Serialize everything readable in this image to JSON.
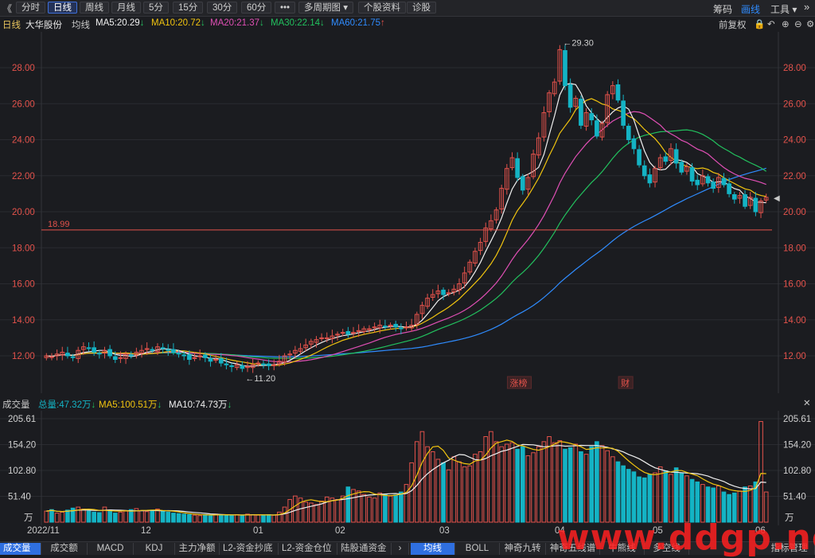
{
  "toolbar": {
    "back_glyph": "《",
    "tabs": [
      "分时",
      "日线",
      "周线",
      "月线",
      "5分",
      "15分",
      "30分",
      "60分",
      "•••",
      "多周期图",
      "个股资料",
      "诊股"
    ],
    "active_tab": "日线",
    "right_items": [
      "筹码",
      "画线",
      "工具"
    ],
    "active_right": "画线"
  },
  "ma_header": {
    "period": "日线",
    "stock_name": "大华股份",
    "avg_line": "均线",
    "ma5": "MA5:20.29",
    "ma10": "MA10:20.72",
    "ma20": "MA20:21.37",
    "ma30": "MA30:22.14",
    "ma60": "MA60:21.75",
    "adjust": "前复权"
  },
  "colors": {
    "up": "#e3524b",
    "down": "#14b3c4",
    "ma5": "#f0f0f0",
    "ma10": "#f1c40f",
    "ma20": "#e04fb5",
    "ma30": "#22c15e",
    "ma60": "#2f8cff",
    "background": "#1b1c20"
  },
  "price_axis": {
    "labels": [
      "28.00",
      "26.00",
      "24.00",
      "22.00",
      "20.00",
      "18.00",
      "16.00",
      "14.00",
      "12.00"
    ],
    "values": [
      28,
      26,
      24,
      22,
      20,
      18,
      16,
      14,
      12
    ]
  },
  "annotations": {
    "high": "←29.30",
    "low": "←11.20",
    "hline": "18.99",
    "tag1": "涨榜",
    "tag2": "财"
  },
  "volume_header": {
    "title": "成交量",
    "total": "总量:47.32万",
    "ma5": "MA5:100.51万",
    "ma10": "MA10:74.73万"
  },
  "volume_axis": {
    "labels": [
      "205.61",
      "154.20",
      "102.80",
      "51.40",
      "万"
    ]
  },
  "time_axis": [
    "2022/11",
    "12",
    "01",
    "02",
    "03",
    "04",
    "05",
    "06"
  ],
  "bottom_tabs": [
    "成交量",
    "成交额",
    "MACD",
    "KDJ",
    "主力净额",
    "L2-资金抄底",
    "L2-资金仓位",
    "陆股通资金",
    "›",
    "均线",
    "BOLL",
    "神奇九转",
    "神奇五线谱",
    "牛熊线",
    "多空线",
    "指标管理"
  ],
  "bottom_active": [
    "成交量",
    "均线"
  ],
  "watermark": "www.ddgp.net",
  "chart_data": {
    "type": "candlestick",
    "ylim": [
      11,
      29.3
    ],
    "high": 29.3,
    "low": 11.2,
    "hline": 18.99,
    "ma_last": {
      "ma5": 20.29,
      "ma10": 20.72,
      "ma20": 21.37,
      "ma30": 22.14,
      "ma60": 21.75
    },
    "closes": [
      12.0,
      11.95,
      12.1,
      12.2,
      12.0,
      11.9,
      12.3,
      12.5,
      12.4,
      12.2,
      12.1,
      12.3,
      12.0,
      11.8,
      11.9,
      12.1,
      12.0,
      12.2,
      12.3,
      12.4,
      12.3,
      12.5,
      12.4,
      12.3,
      12.2,
      12.1,
      12.0,
      11.8,
      11.9,
      12.0,
      11.9,
      11.7,
      11.8,
      11.6,
      11.5,
      11.4,
      11.5,
      11.3,
      11.4,
      11.5,
      11.6,
      11.5,
      11.45,
      11.5,
      11.7,
      12.0,
      12.1,
      12.3,
      12.4,
      12.6,
      12.8,
      12.9,
      13.0,
      13.0,
      13.1,
      13.2,
      13.3,
      13.2,
      13.3,
      13.4,
      13.5,
      13.5,
      13.6,
      13.7,
      13.6,
      13.7,
      13.6,
      13.5,
      13.6,
      13.7,
      14.3,
      14.8,
      15.2,
      15.4,
      15.6,
      15.4,
      15.5,
      15.7,
      16.0,
      16.6,
      17.2,
      17.8,
      18.3,
      19.1,
      19.5,
      20.1,
      21.3,
      22.4,
      23.0,
      21.9,
      21.2,
      21.9,
      23.2,
      24.1,
      25.5,
      26.6,
      27.2,
      29.0,
      27.0,
      25.8,
      26.3,
      24.8,
      25.5,
      25.1,
      24.2,
      24.9,
      26.5,
      27.0,
      26.2,
      24.8,
      24.0,
      23.5,
      22.6,
      22.0,
      21.6,
      22.4,
      23.0,
      22.8,
      23.5,
      22.7,
      22.2,
      22.5,
      21.7,
      21.5,
      22.0,
      21.6,
      21.3,
      21.9,
      21.5,
      21.0,
      20.7,
      20.9,
      20.3,
      20.8,
      20.0,
      20.6,
      20.8
    ],
    "volumes": [
      22,
      25,
      18,
      20,
      24,
      28,
      30,
      26,
      22,
      20,
      19,
      30,
      24,
      18,
      20,
      22,
      25,
      27,
      23,
      21,
      24,
      26,
      22,
      20,
      18,
      17,
      16,
      15,
      14,
      13,
      15,
      14,
      16,
      15,
      14,
      13,
      15,
      14,
      16,
      15,
      14,
      13,
      15,
      14,
      20,
      30,
      45,
      52,
      48,
      40,
      38,
      35,
      42,
      50,
      48,
      45,
      52,
      70,
      65,
      62,
      55,
      50,
      48,
      58,
      55,
      52,
      54,
      60,
      75,
      118,
      160,
      180,
      150,
      140,
      125,
      118,
      104,
      130,
      120,
      110,
      112,
      135,
      140,
      170,
      180,
      160,
      150,
      155,
      158,
      145,
      150,
      132,
      138,
      150,
      160,
      170,
      158,
      162,
      145,
      148,
      155,
      140,
      135,
      150,
      160,
      152,
      142,
      130,
      120,
      112,
      105,
      100,
      90,
      88,
      95,
      98,
      110,
      102,
      95,
      108,
      98,
      92,
      85,
      80,
      75,
      70,
      68,
      72,
      60,
      55,
      58,
      62,
      70,
      72,
      80,
      200,
      60
    ]
  }
}
